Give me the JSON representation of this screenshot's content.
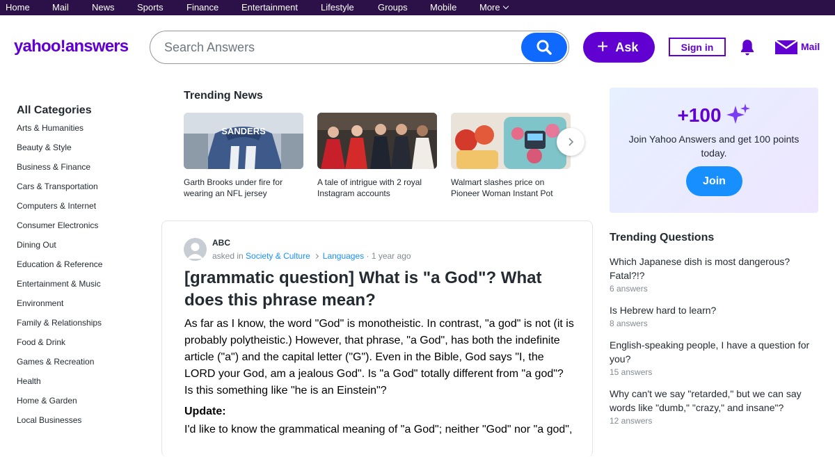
{
  "topnav": {
    "items": [
      {
        "label": "Home"
      },
      {
        "label": "Mail"
      },
      {
        "label": "News"
      },
      {
        "label": "Sports"
      },
      {
        "label": "Finance"
      },
      {
        "label": "Entertainment"
      },
      {
        "label": "Lifestyle"
      },
      {
        "label": "Groups"
      },
      {
        "label": "Mobile"
      },
      {
        "label": "More"
      }
    ]
  },
  "header": {
    "logo": "yahoo!answers",
    "search_placeholder": "Search Answers",
    "ask_label": "Ask",
    "signin_label": "Sign in",
    "mail_label": "Mail"
  },
  "categories": {
    "heading": "All Categories",
    "items": [
      "Arts & Humanities",
      "Beauty & Style",
      "Business & Finance",
      "Cars & Transportation",
      "Computers & Internet",
      "Consumer Electronics",
      "Dining Out",
      "Education & Reference",
      "Entertainment & Music",
      "Environment",
      "Family & Relationships",
      "Food & Drink",
      "Games & Recreation",
      "Health",
      "Home & Garden",
      "Local Businesses"
    ]
  },
  "trending_news": {
    "heading": "Trending News",
    "items": [
      {
        "caption": "Garth Brooks under fire for wearing an NFL jersey",
        "jersey_text": "SANDERS"
      },
      {
        "caption": "A tale of intrigue with 2 royal Instagram accounts"
      },
      {
        "caption": "Walmart slashes price on Pioneer Woman Instant Pot"
      }
    ]
  },
  "question": {
    "asker": "ABC",
    "asked_in": "asked in",
    "category": "Society & Culture",
    "subcategory": "Languages",
    "age": "· 1 year ago",
    "title": "[grammatic question] What is \"a God\"? What does this phrase mean?",
    "body": "As far as I know, the word \"God\" is monotheistic. In contrast, \"a god\" is not (it is probably polytheistic.) However, that phrase, \"a God\", has both the indefinite article (\"a\") and the capital letter (\"G\"). Even in the Bible, God says \"I, the LORD your God, am a jealous God\". Is \"a God\" totally different from \"a god\"? Is this something like \"he is an Einstein\"?",
    "update_label": "Update:",
    "update_body": "I'd like to know the grammatical meaning of \"a God\"; neither \"God\" nor \"a god\","
  },
  "promo": {
    "points": "+100",
    "text": "Join Yahoo Answers and get 100 points today.",
    "join_label": "Join"
  },
  "trending_questions": {
    "heading": "Trending Questions",
    "items": [
      {
        "q": "Which Japanese dish is most dangerous? Fatal?!?",
        "n": "6 answers"
      },
      {
        "q": "Is Hebrew hard to learn?",
        "n": "8 answers"
      },
      {
        "q": "English-speaking people, I have a question for you?",
        "n": "15 answers"
      },
      {
        "q": "Why can't we say \"retarded,\" but we can say words like \"dumb,\" \"crazy,\" and insane\"?",
        "n": "12 answers"
      }
    ]
  },
  "colors": {
    "brand": "#6001d2",
    "nav_bg": "#2c1048",
    "search_blue": "#0f69ff",
    "link_blue": "#188fff"
  }
}
